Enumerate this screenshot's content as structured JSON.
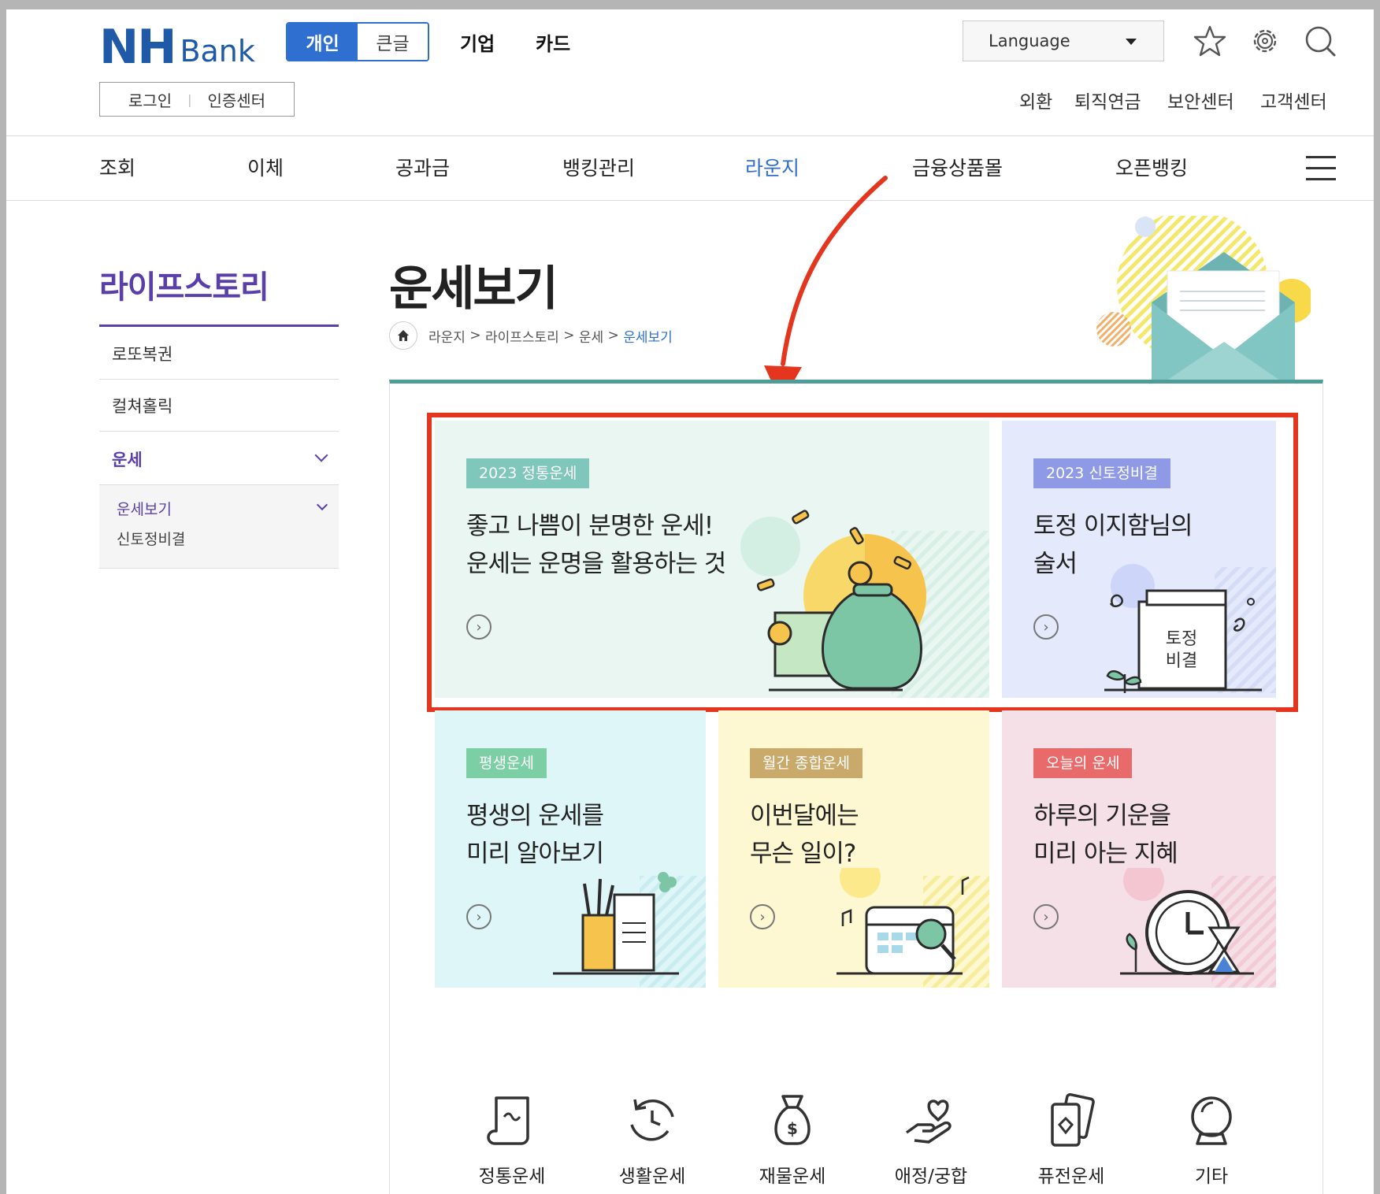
{
  "header": {
    "logo_nh": "NH",
    "logo_bank": "Bank",
    "mode_personal": "개인",
    "mode_bigtext": "큰글",
    "nav_corporate": "기업",
    "nav_card": "카드",
    "login": "로그인",
    "cert_center": "인증센터",
    "language": "Language",
    "utility": [
      "외환",
      "퇴직연금",
      "보안센터",
      "고객센터"
    ]
  },
  "gnb": [
    "조회",
    "이체",
    "공과금",
    "뱅킹관리",
    "라운지",
    "금융상품몰",
    "오픈뱅킹"
  ],
  "lnb": {
    "title": "라이프스토리",
    "items": [
      "로또복권",
      "컬쳐홀릭",
      "운세"
    ],
    "sub": [
      "운세보기",
      "신토정비결"
    ]
  },
  "page": {
    "title": "운세보기",
    "breadcrumb": [
      "라운지",
      "라이프스토리",
      "운세",
      "운세보기"
    ]
  },
  "cards": [
    {
      "tag": "2023 정통운세",
      "line1": "좋고 나쁨이 분명한 운세!",
      "line2": "운세는 운명을 활용하는 것",
      "color": "#e9f6f2",
      "tag_color": "#7fc6bb"
    },
    {
      "tag": "2023 신토정비결",
      "line1": "토정 이지함님의",
      "line2": "술서",
      "book_line1": "토정",
      "book_line2": "비결",
      "color": "#e4e9fb",
      "tag_color": "#8e9ae6"
    },
    {
      "tag": "평생운세",
      "line1": "평생의 운세를",
      "line2": "미리 알아보기",
      "color": "#dff6f8",
      "tag_color": "#7ccfa4"
    },
    {
      "tag": "월간 종합운세",
      "line1": "이번달에는",
      "line2": "무슨 일이?",
      "color": "#fdf8d2",
      "tag_color": "#c9aa6a"
    },
    {
      "tag": "오늘의 운세",
      "line1": "하루의 기운을",
      "line2": "미리 아는 지혜",
      "color": "#f6e0e7",
      "tag_color": "#e96a6a"
    }
  ],
  "categories": [
    "정통운세",
    "생활운세",
    "재물운세",
    "애정/궁합",
    "퓨전운세",
    "기타"
  ],
  "accent": {
    "highlight_red": "#e4351f",
    "brand_blue": "#2f6fcf",
    "lnb_purple": "#5a3fa9",
    "panel_teal": "#4e9d98"
  }
}
